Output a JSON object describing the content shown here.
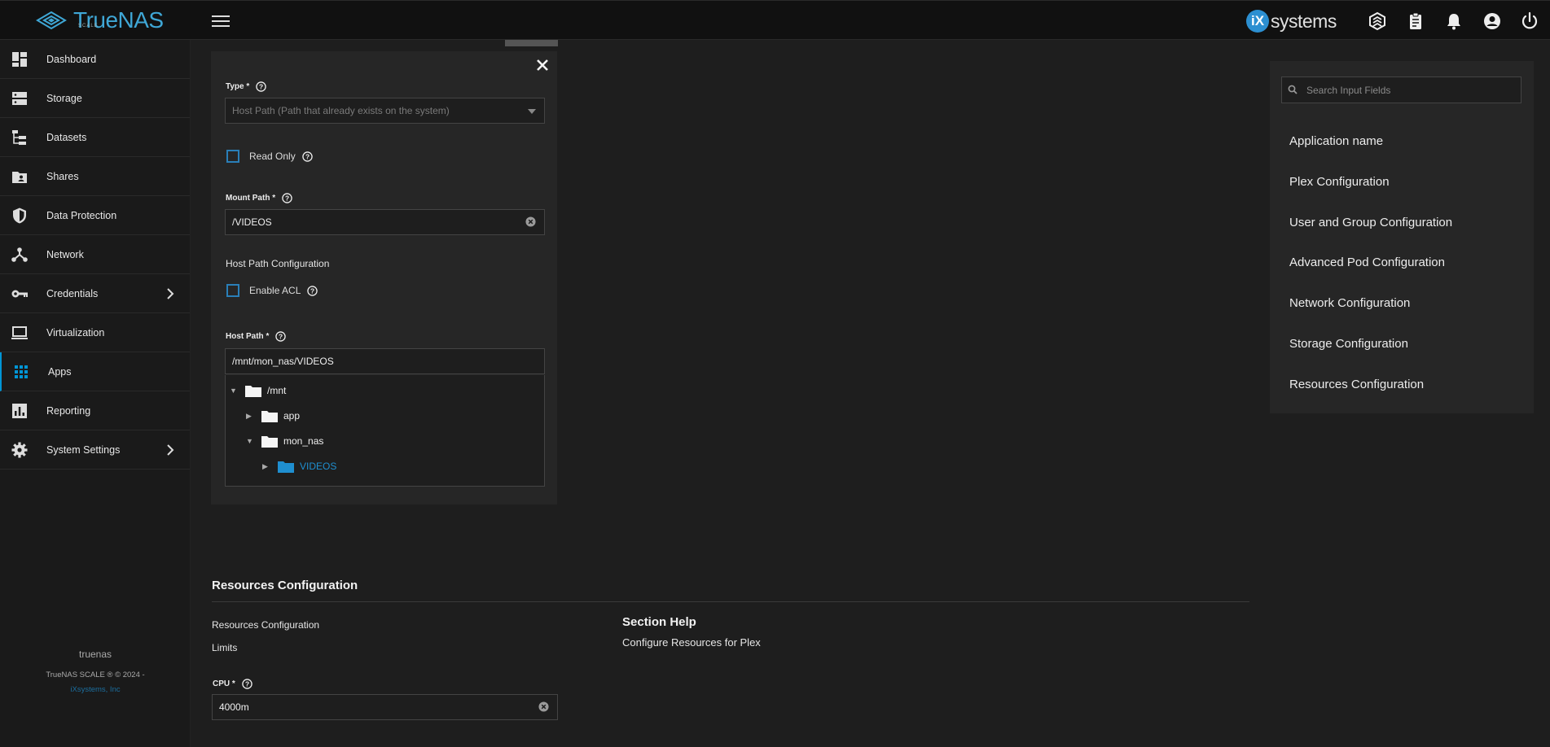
{
  "header": {
    "brand": "TrueNAS",
    "brand_sub": "SCALE",
    "vendor_badge": "iX",
    "vendor": "systems"
  },
  "sidebar": {
    "items": [
      {
        "label": "Dashboard",
        "icon": "dashboard-icon"
      },
      {
        "label": "Storage",
        "icon": "storage-icon"
      },
      {
        "label": "Datasets",
        "icon": "datasets-icon"
      },
      {
        "label": "Shares",
        "icon": "shares-icon"
      },
      {
        "label": "Data Protection",
        "icon": "shield-icon"
      },
      {
        "label": "Network",
        "icon": "network-icon"
      },
      {
        "label": "Credentials",
        "icon": "key-icon"
      },
      {
        "label": "Virtualization",
        "icon": "laptop-icon"
      },
      {
        "label": "Apps",
        "icon": "apps-grid-icon"
      },
      {
        "label": "Reporting",
        "icon": "reporting-icon"
      },
      {
        "label": "System Settings",
        "icon": "gear-icon"
      }
    ],
    "hostname": "truenas",
    "copyright": "TrueNAS SCALE ® © 2024 -",
    "company": "iXsystems, Inc"
  },
  "form": {
    "type_label": "Type *",
    "type_value": "Host Path (Path that already exists on the system)",
    "read_only_label": "Read Only",
    "mount_path_label": "Mount Path *",
    "mount_path_value": "/VIDEOS",
    "host_path_config_title": "Host Path Configuration",
    "enable_acl_label": "Enable ACL",
    "host_path_label": "Host Path *",
    "host_path_value": "/mnt/mon_nas/VIDEOS",
    "tree": [
      {
        "name": "/mnt",
        "expanded": true
      },
      {
        "name": "app",
        "expanded": false
      },
      {
        "name": "mon_nas",
        "expanded": true
      },
      {
        "name": "VIDEOS",
        "expanded": false,
        "selected": true
      }
    ]
  },
  "resources": {
    "section_title": "Resources Configuration",
    "sub_title": "Resources Configuration",
    "limits": "Limits",
    "help_title": "Section Help",
    "help_text": "Configure Resources for Plex",
    "cpu_label": "CPU *",
    "cpu_value": "4000m"
  },
  "right_panel": {
    "search_placeholder": "Search Input Fields",
    "links": [
      "Application name",
      "Plex Configuration",
      "User and Group Configuration",
      "Advanced Pod Configuration",
      "Network Configuration",
      "Storage Configuration",
      "Resources Configuration"
    ]
  },
  "colors": {
    "accent": "#0095d5",
    "brand": "#3fa7d6",
    "background": "#1e1e1e"
  }
}
